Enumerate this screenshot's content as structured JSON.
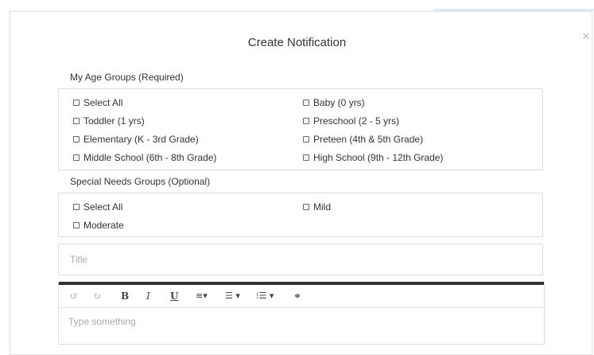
{
  "dialog": {
    "title": "Create Notification",
    "close_glyph": "×"
  },
  "age_groups": {
    "label": "My Age Groups (Required)",
    "options": [
      "Select All",
      "Baby (0 yrs)",
      "Toddler (1 yrs)",
      "Preschool (2 - 5 yrs)",
      "Elementary (K - 3rd Grade)",
      "Preteen (4th & 5th Grade)",
      "Middle School (6th - 8th Grade)",
      "High School (9th - 12th Grade)"
    ]
  },
  "special_needs": {
    "label": "Special Needs Groups (Optional)",
    "options": [
      "Select All",
      "Mild",
      "Moderate"
    ]
  },
  "title_field": {
    "placeholder": "Title"
  },
  "editor": {
    "placeholder": "Type something",
    "toolbar": {
      "undo": "↺",
      "redo": "↻",
      "bold": "B",
      "italic": "I",
      "underline": "U",
      "align": "≡▾",
      "bulleted_list": "☰ ▾",
      "numbered_list": "⁝☰ ▾",
      "link": "⚭"
    }
  }
}
